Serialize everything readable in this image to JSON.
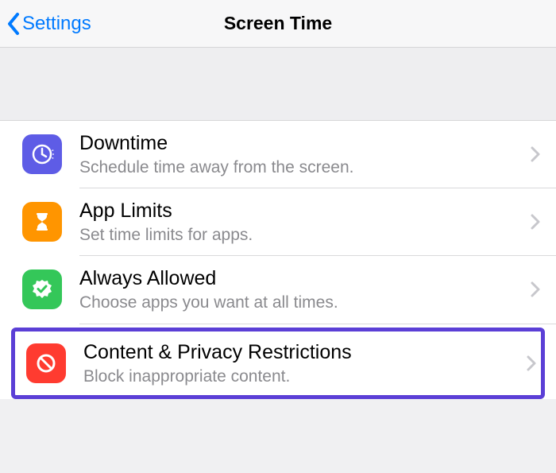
{
  "nav": {
    "back_label": "Settings",
    "title": "Screen Time"
  },
  "items": [
    {
      "title": "Downtime",
      "subtitle": "Schedule time away from the screen."
    },
    {
      "title": "App Limits",
      "subtitle": "Set time limits for apps."
    },
    {
      "title": "Always Allowed",
      "subtitle": "Choose apps you want at all times."
    },
    {
      "title": "Content & Privacy Restrictions",
      "subtitle": "Block inappropriate content."
    }
  ],
  "colors": {
    "accent_link": "#007aff",
    "highlight_border": "#5b3fd6",
    "icon_downtime": "#5e5ce6",
    "icon_applimits": "#ff9500",
    "icon_always": "#34c759",
    "icon_content": "#ff3b30"
  }
}
